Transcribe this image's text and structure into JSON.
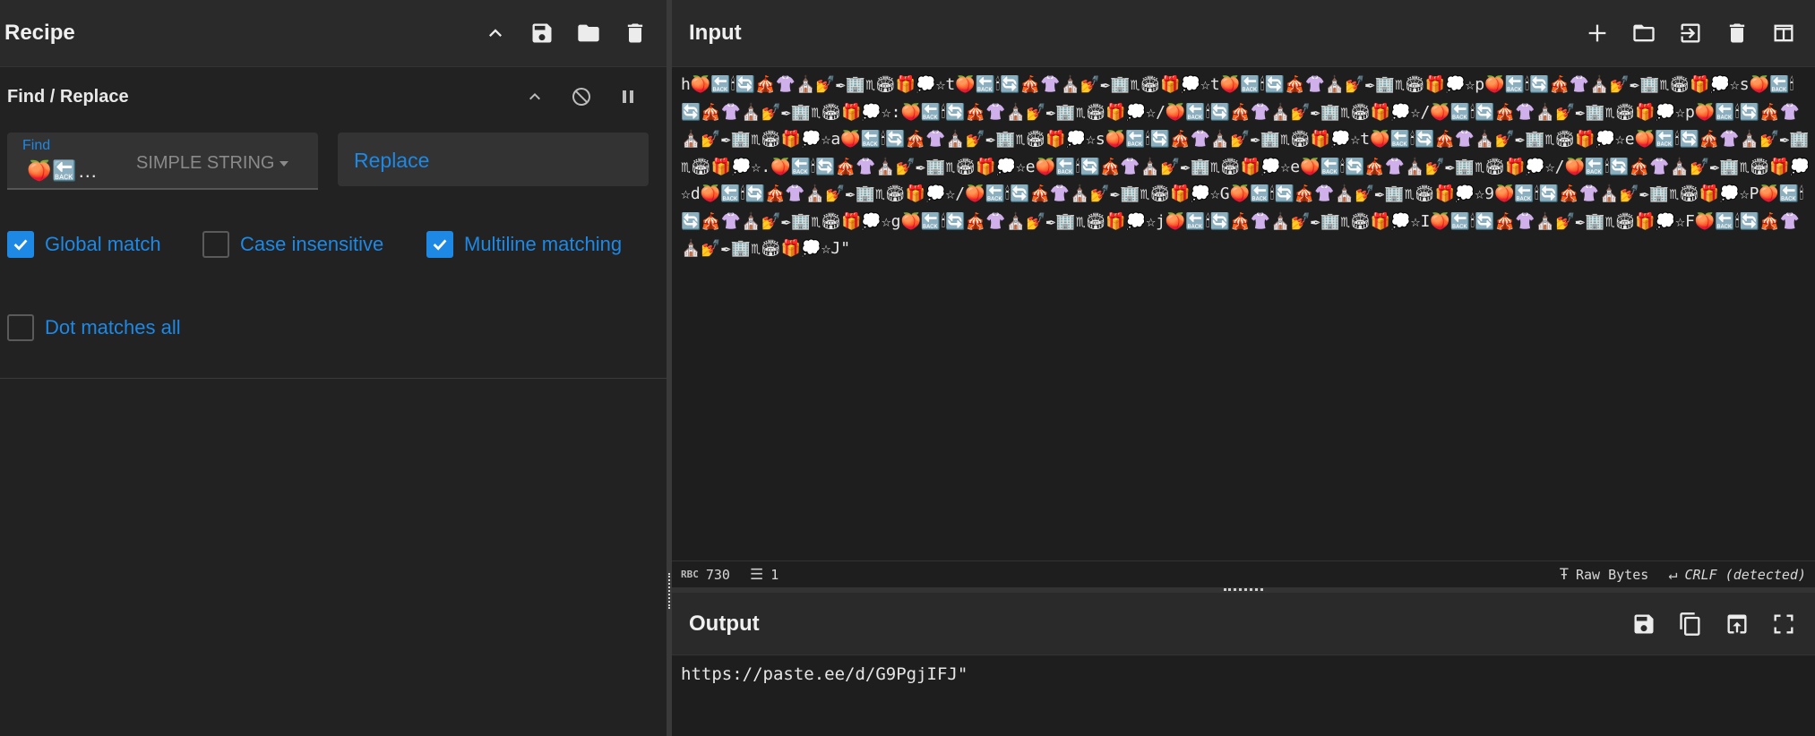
{
  "recipe": {
    "title": "Recipe",
    "operation": {
      "title": "Find / Replace",
      "find": {
        "label": "Find",
        "value": "🍑🔙…",
        "type": "SIMPLE STRING"
      },
      "replace": {
        "placeholder": "Replace"
      },
      "options": [
        {
          "label": "Global match",
          "checked": true
        },
        {
          "label": "Case insensitive",
          "checked": false
        },
        {
          "label": "Multiline matching",
          "checked": true
        },
        {
          "label": "Dot matches all",
          "checked": false
        }
      ]
    }
  },
  "input": {
    "title": "Input",
    "text": "h🍑🔙🕯🔄🎪👚⛪💅✒🏢♏🏟🎁💭☆t🍑🔙🕯🔄🎪👚⛪💅✒🏢♏🏟🎁💭☆t🍑🔙🕯🔄🎪👚⛪💅✒🏢♏🏟🎁💭☆p🍑🔙🕯🔄🎪👚⛪💅✒🏢♏🏟🎁💭☆s🍑🔙🕯🔄🎪👚⛪💅✒🏢♏🏟🎁💭☆:🍑🔙🕯🔄🎪👚⛪💅✒🏢♏🏟🎁💭☆/🍑🔙🕯🔄🎪👚⛪💅✒🏢♏🏟🎁💭☆/🍑🔙🕯🔄🎪👚⛪💅✒🏢♏🏟🎁💭☆p🍑🔙🕯🔄🎪👚⛪💅✒🏢♏🏟🎁💭☆a🍑🔙🕯🔄🎪👚⛪💅✒🏢♏🏟🎁💭☆s🍑🔙🕯🔄🎪👚⛪💅✒🏢♏🏟🎁💭☆t🍑🔙🕯🔄🎪👚⛪💅✒🏢♏🏟🎁💭☆e🍑🔙🕯🔄🎪👚⛪💅✒🏢♏🏟🎁💭☆.🍑🔙🕯🔄🎪👚⛪💅✒🏢♏🏟🎁💭☆e🍑🔙🕯🔄🎪👚⛪💅✒🏢♏🏟🎁💭☆e🍑🔙🕯🔄🎪👚⛪💅✒🏢♏🏟🎁💭☆/🍑🔙🕯🔄🎪👚⛪💅✒🏢♏🏟🎁💭☆d🍑🔙🕯🔄🎪👚⛪💅✒🏢♏🏟🎁💭☆/🍑🔙🕯🔄🎪👚⛪💅✒🏢♏🏟🎁💭☆G🍑🔙🕯🔄🎪👚⛪💅✒🏢♏🏟🎁💭☆9🍑🔙🕯🔄🎪👚⛪💅✒🏢♏🏟🎁💭☆P🍑🔙🕯🔄🎪👚⛪💅✒🏢♏🏟🎁💭☆g🍑🔙🕯🔄🎪👚⛪💅✒🏢♏🏟🎁💭☆j🍑🔙🕯🔄🎪👚⛪💅✒🏢♏🏟🎁💭☆I🍑🔙🕯🔄🎪👚⛪💅✒🏢♏🏟🎁💭☆F🍑🔙🕯🔄🎪👚⛪💅✒🏢♏🏟🎁💭☆J\"",
    "status": {
      "chars_icon": "RBC",
      "chars": "730",
      "lines": "1",
      "format": "Raw Bytes",
      "eol": "CRLF (detected)"
    }
  },
  "output": {
    "title": "Output",
    "text": "https://paste.ee/d/G9PgjIFJ\""
  }
}
